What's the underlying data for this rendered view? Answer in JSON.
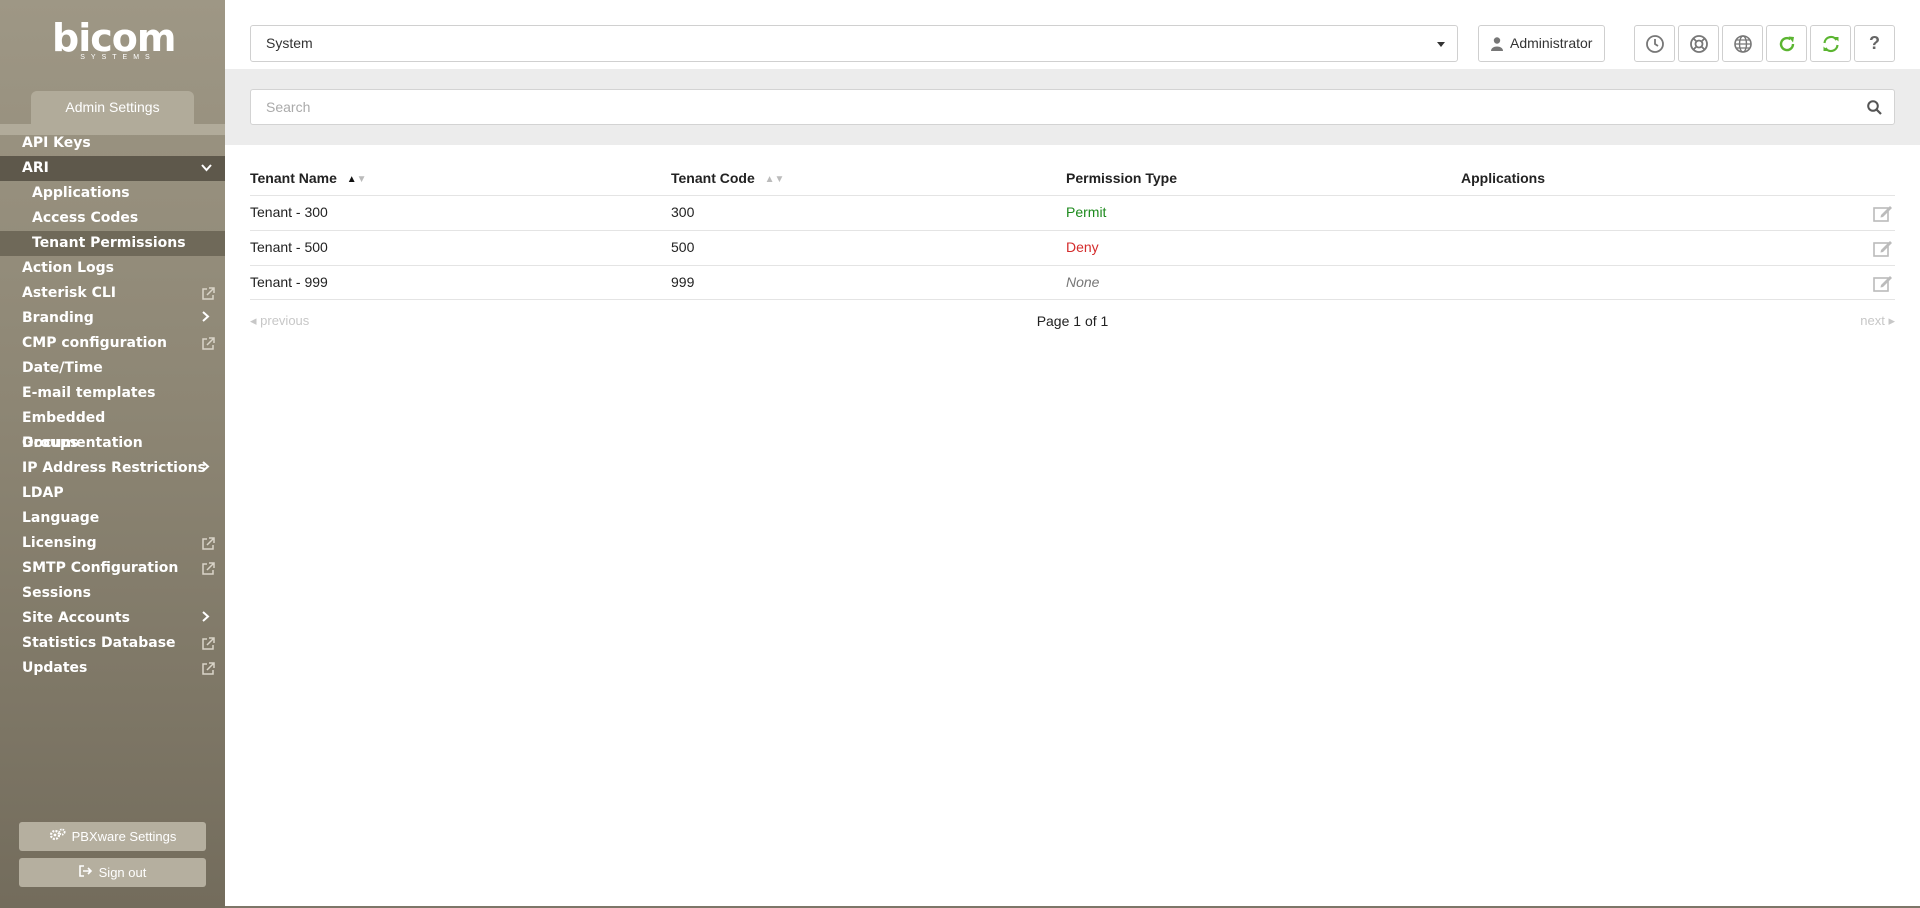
{
  "brand": {
    "name": "bicom",
    "tagline": "SYSTEMS"
  },
  "sidebar": {
    "section_tab": "Admin Settings",
    "items": [
      {
        "label": "API Keys"
      },
      {
        "label": "ARI",
        "indicator": "chevron-down"
      },
      {
        "label": "Applications",
        "sub": true
      },
      {
        "label": "Access Codes",
        "sub": true
      },
      {
        "label": "Tenant Permissions",
        "sub": true,
        "selected": true
      },
      {
        "label": "Action Logs"
      },
      {
        "label": "Asterisk CLI",
        "indicator": "external-link"
      },
      {
        "label": "Branding",
        "indicator": "chevron-right"
      },
      {
        "label": "CMP configuration",
        "indicator": "external-link"
      },
      {
        "label": "Date/Time"
      },
      {
        "label": "E-mail templates"
      },
      {
        "label": "Embedded Documentation"
      },
      {
        "label": "Groups"
      },
      {
        "label": "IP Address Restrictions",
        "indicator": "chevron-right"
      },
      {
        "label": "LDAP"
      },
      {
        "label": "Language"
      },
      {
        "label": "Licensing",
        "indicator": "external-link"
      },
      {
        "label": "SMTP Configuration",
        "indicator": "external-link"
      },
      {
        "label": "Sessions"
      },
      {
        "label": "Site Accounts",
        "indicator": "chevron-right"
      },
      {
        "label": "Statistics Database",
        "indicator": "external-link"
      },
      {
        "label": "Updates",
        "indicator": "external-link"
      }
    ],
    "pbxware_settings": "PBXware Settings",
    "sign_out": "Sign out"
  },
  "header": {
    "system_select": "System",
    "user_button": "Administrator",
    "icon_buttons": [
      "clock-icon",
      "support-icon",
      "globe-icon",
      "reload-icon",
      "sync-icon",
      "help-icon"
    ],
    "help_glyph": "?"
  },
  "search": {
    "placeholder": "Search"
  },
  "table": {
    "columns": [
      "Tenant Name",
      "Tenant Code",
      "Permission Type",
      "Applications"
    ],
    "rows": [
      {
        "name": "Tenant - 300",
        "code": "300",
        "permission": "Permit",
        "applications": ""
      },
      {
        "name": "Tenant - 500",
        "code": "500",
        "permission": "Deny",
        "applications": ""
      },
      {
        "name": "Tenant - 999",
        "code": "999",
        "permission": "None",
        "applications": ""
      }
    ]
  },
  "pager": {
    "previous": "previous",
    "page_text": "Page 1 of 1",
    "next": "next"
  },
  "colors": {
    "permit": "#1d8a1d",
    "deny": "#d42c2c",
    "accent_green": "#5bb531",
    "sidebar_bg": "#8d8674"
  }
}
